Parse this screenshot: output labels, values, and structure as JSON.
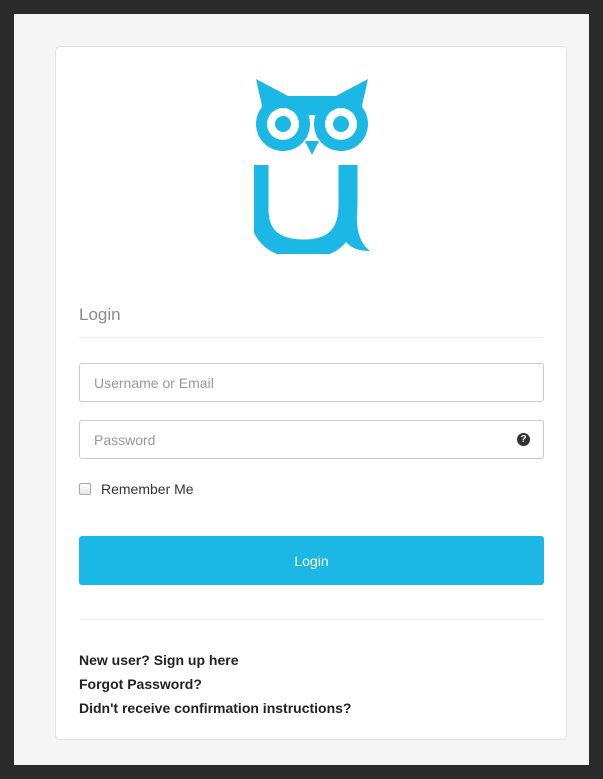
{
  "logo": {
    "icon": "owl-u-logo-icon",
    "color": "#1bb8e6"
  },
  "form": {
    "title": "Login",
    "username_placeholder": "Username or Email",
    "password_placeholder": "Password",
    "password_help_icon": "question-circle-icon",
    "password_help_glyph": "?",
    "remember_label": "Remember Me",
    "remember_checked": false,
    "submit_label": "Login"
  },
  "links": [
    {
      "label": "New user? Sign up here"
    },
    {
      "label": "Forgot Password?"
    },
    {
      "label": "Didn't receive confirmation instructions?"
    }
  ],
  "colors": {
    "accent": "#1bb8e6",
    "frame": "#2b2b2b",
    "background": "#f5f5f5",
    "card": "#ffffff"
  }
}
